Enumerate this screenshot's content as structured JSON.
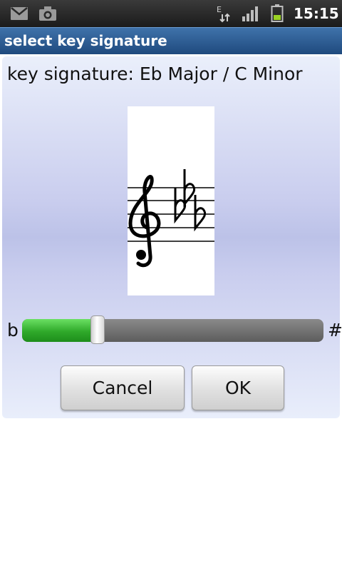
{
  "status_bar": {
    "time": "15:15",
    "icons": [
      "gmail-icon",
      "camera-icon",
      "edge-data-icon",
      "signal-icon",
      "battery-icon"
    ],
    "data_indicator": "E"
  },
  "dialog": {
    "title": "select key signature",
    "key_signature_label": "key signature:",
    "key_signature_value": "Eb Major / C Minor",
    "staff": {
      "clef": "treble",
      "accidentals": [
        "flat",
        "flat",
        "flat"
      ]
    },
    "slider": {
      "left_label": "b",
      "right_label": "#",
      "value": 0.25,
      "fill_color": "#2fa92a"
    },
    "buttons": {
      "cancel": "Cancel",
      "ok": "OK"
    }
  },
  "colors": {
    "title_bar": "#2b5a92",
    "status_bar": "#222222",
    "panel_mid": "#bcc2e8"
  }
}
